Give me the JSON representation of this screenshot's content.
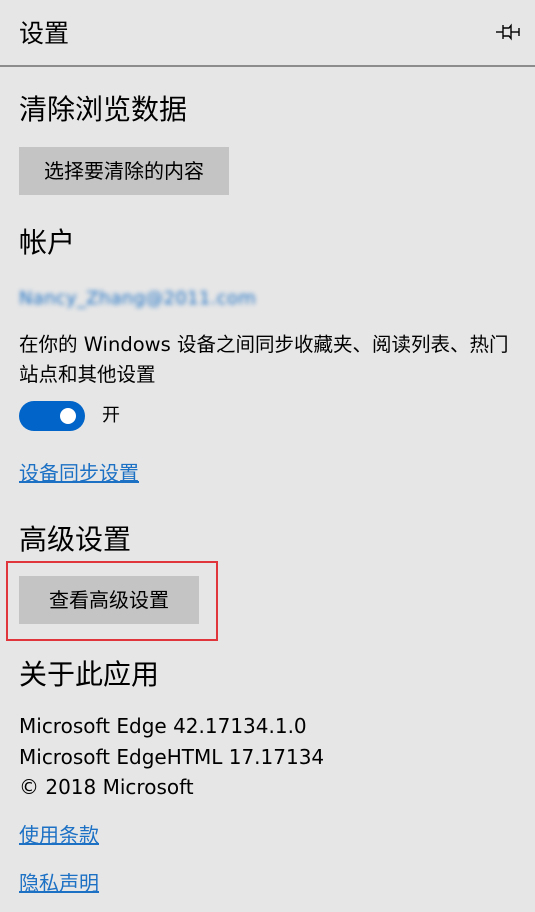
{
  "header": {
    "title": "设置",
    "pin_icon": "pin-icon"
  },
  "clear_data": {
    "heading": "清除浏览数据",
    "button_label": "选择要清除的内容"
  },
  "account": {
    "heading": "帐户",
    "email": "Nancy_Zhang@2011.com",
    "sync_description": "在你的 Windows 设备之间同步收藏夹、阅读列表、热门站点和其他设置",
    "toggle_state": "开",
    "toggle_on": true,
    "sync_settings_link": "设备同步设置"
  },
  "advanced": {
    "heading": "高级设置",
    "button_label": "查看高级设置"
  },
  "about": {
    "heading": "关于此应用",
    "line1": "Microsoft Edge 42.17134.1.0",
    "line2": "Microsoft EdgeHTML 17.17134",
    "line3": "© 2018 Microsoft",
    "terms_link": "使用条款",
    "privacy_link": "隐私声明"
  },
  "colors": {
    "background": "#e6e6e6",
    "button": "#c4c4c4",
    "accent": "#0064c8",
    "link": "#1d71c5",
    "highlight": "#e0363b"
  }
}
